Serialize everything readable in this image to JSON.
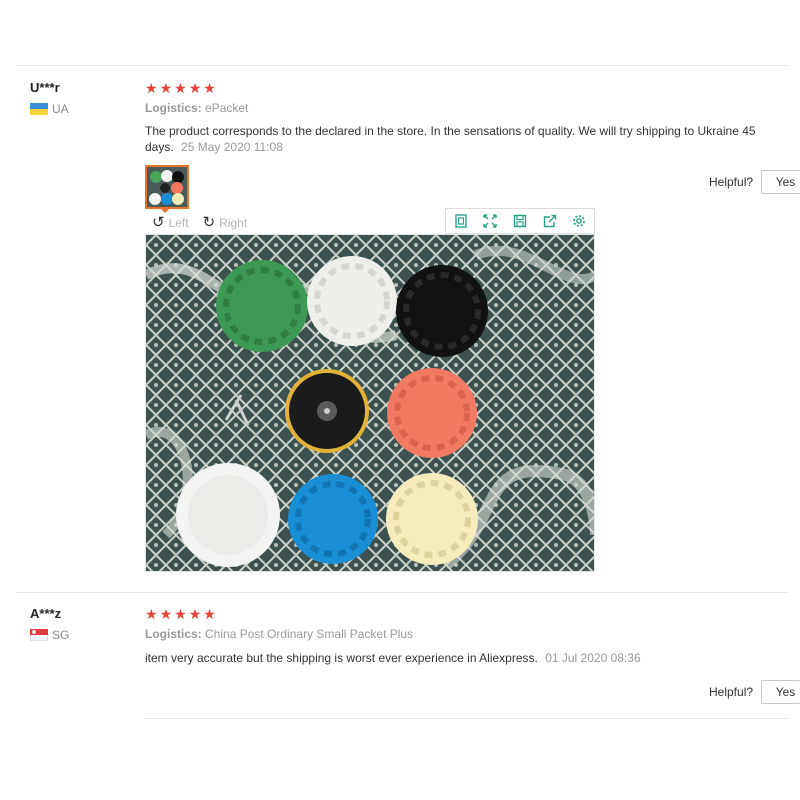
{
  "reviews": [
    {
      "user": "U***r",
      "country": "UA",
      "stars": 5,
      "logistics_label": "Logistics:",
      "logistics_value": "ePacket",
      "text": "The product corresponds to the declared in the store. In the sensations of quality. We will try shipping to Ukraine 45 days.",
      "date": "25 May 2020 11:08",
      "helpful_label": "Helpful?",
      "yes_label": "Yes"
    },
    {
      "user": "A***z",
      "country": "SG",
      "stars": 5,
      "logistics_label": "Logistics:",
      "logistics_value": "China Post Ordinary Small Packet Plus",
      "text": "item very accurate but the shipping is worst ever experience in Aliexpress.",
      "date": "01 Jul 2020 08:36",
      "helpful_label": "Helpful?",
      "yes_label": "Yes"
    }
  ],
  "image_viewer": {
    "rotate_left_label": "Left",
    "rotate_right_label": "Right",
    "tools": [
      "fit-screen-icon",
      "fullscreen-icon",
      "save-icon",
      "share-icon",
      "settings-icon"
    ]
  },
  "colors": {
    "star": "#e8423a",
    "accent_tool": "#2aa088",
    "thumb_border": "#e8732a"
  }
}
